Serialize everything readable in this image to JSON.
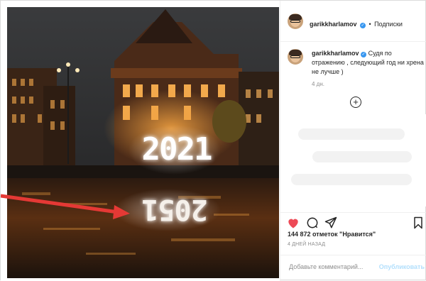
{
  "post": {
    "author": {
      "username": "garikkharlamov",
      "follow_label": "Подписки",
      "separator": "•"
    },
    "caption": {
      "username": "garikkharlamov",
      "text": "Судя по отражению , следующий год ни хрена не лучше )",
      "time": "4 дн."
    },
    "photo": {
      "sign_text": "2021",
      "reflection_text": "2051"
    },
    "likes_text": "144 872 отметок \"Нравится\"",
    "time_ago": "4 ДНЕЙ НАЗАД",
    "comment_input": {
      "placeholder": "Добавьте комментарий...",
      "publish_label": "Опубликовать"
    },
    "icons": {
      "like": "heart-icon",
      "comment": "comment-icon",
      "share": "share-icon",
      "save": "bookmark-icon",
      "more": "plus-circle-icon",
      "verified": "verified-badge-icon"
    },
    "colors": {
      "heart": "#ed4956",
      "verified": "#3897f0",
      "arrow": "#e53935",
      "sign_glow": "#ffffff",
      "publish_disabled": "#b2dffc"
    }
  }
}
